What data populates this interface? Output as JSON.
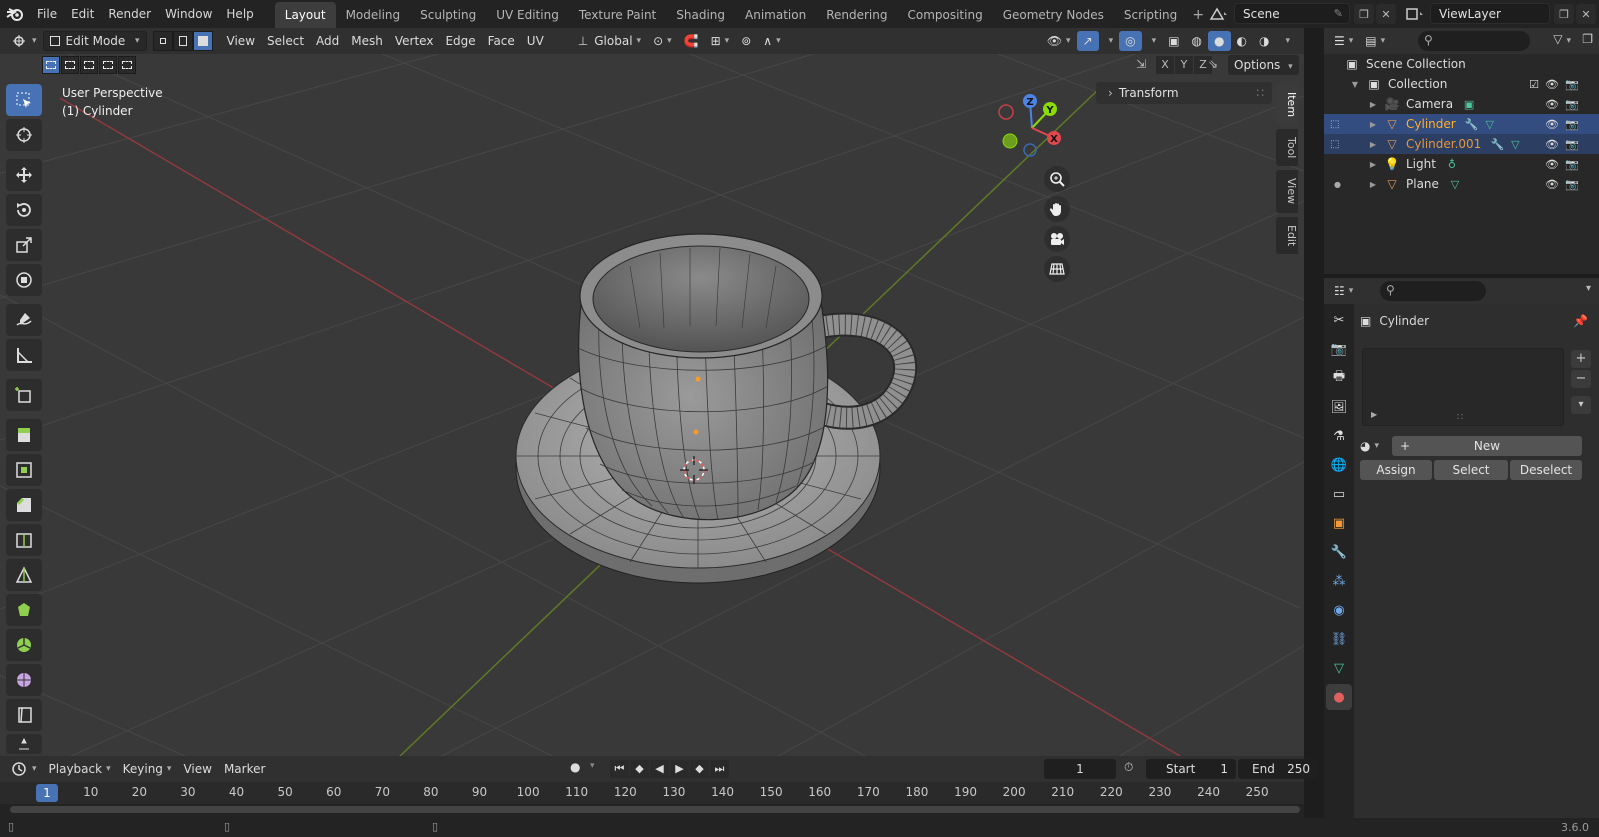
{
  "menu": [
    "File",
    "Edit",
    "Render",
    "Window",
    "Help"
  ],
  "workspaces": [
    {
      "label": "Layout",
      "active": true
    },
    {
      "label": "Modeling",
      "active": false
    },
    {
      "label": "Sculpting",
      "active": false
    },
    {
      "label": "UV Editing",
      "active": false
    },
    {
      "label": "Texture Paint",
      "active": false
    },
    {
      "label": "Shading",
      "active": false
    },
    {
      "label": "Animation",
      "active": false
    },
    {
      "label": "Rendering",
      "active": false
    },
    {
      "label": "Compositing",
      "active": false
    },
    {
      "label": "Geometry Nodes",
      "active": false
    },
    {
      "label": "Scripting",
      "active": false
    }
  ],
  "scene": "Scene",
  "view_layer": "ViewLayer",
  "viewport": {
    "mode": "Edit Mode",
    "menus": [
      "View",
      "Select",
      "Add",
      "Mesh",
      "Vertex",
      "Edge",
      "Face",
      "UV"
    ],
    "orientation": "Global",
    "options": "Options",
    "axes": [
      "X",
      "Y",
      "Z"
    ],
    "info_line1": "User Perspective",
    "info_line2": "(1) Cylinder",
    "transform_panel": "Transform",
    "side_tabs": [
      "Item",
      "Tool",
      "View",
      "Edit"
    ]
  },
  "timeline": {
    "menus": [
      "Playback",
      "Keying",
      "View",
      "Marker"
    ],
    "current_frame": "1",
    "start_label": "Start",
    "start_value": "1",
    "end_label": "End",
    "end_value": "250",
    "ticks": [
      "10",
      "20",
      "30",
      "40",
      "50",
      "60",
      "70",
      "80",
      "90",
      "100",
      "110",
      "120",
      "130",
      "140",
      "150",
      "160",
      "170",
      "180",
      "190",
      "200",
      "210",
      "220",
      "230",
      "240",
      "250"
    ]
  },
  "outliner": {
    "root": "Scene Collection",
    "collection": "Collection",
    "items": [
      {
        "name": "Camera",
        "type": "camera",
        "state": "normal"
      },
      {
        "name": "Cylinder",
        "type": "mesh",
        "state": "active"
      },
      {
        "name": "Cylinder.001",
        "type": "mesh",
        "state": "selected"
      },
      {
        "name": "Light",
        "type": "light",
        "state": "normal"
      },
      {
        "name": "Plane",
        "type": "mesh",
        "state": "normal"
      }
    ]
  },
  "properties": {
    "object_name": "Cylinder",
    "new_label": "New",
    "assign_label": "Assign",
    "select_label": "Select",
    "deselect_label": "Deselect"
  },
  "status": {
    "version": "3.6.0"
  },
  "colors": {
    "accent": "#4772b3",
    "active_object": "#ffaf29",
    "x_axis": "#e0474c",
    "y_axis": "#8bdc00",
    "z_axis": "#4c84e6"
  }
}
